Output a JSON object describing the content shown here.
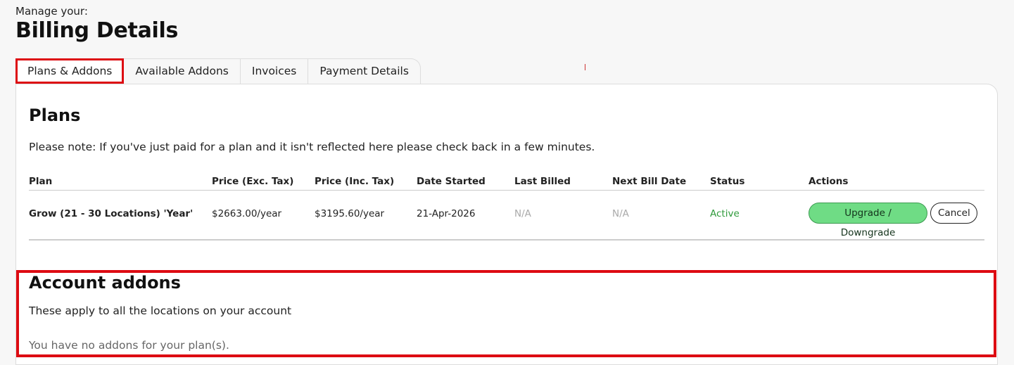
{
  "header": {
    "subtitle": "Manage your:",
    "title": "Billing Details"
  },
  "tabs": [
    {
      "label": "Plans & Addons",
      "active": true
    },
    {
      "label": "Available Addons",
      "active": false
    },
    {
      "label": "Invoices",
      "active": false
    },
    {
      "label": "Payment Details",
      "active": false
    }
  ],
  "plans": {
    "heading": "Plans",
    "note": "Please note: If you've just paid for a plan and it isn't reflected here please check back in a few minutes.",
    "columns": [
      "Plan",
      "Price (Exc. Tax)",
      "Price (Inc. Tax)",
      "Date Started",
      "Last Billed",
      "Next Bill Date",
      "Status",
      "Actions"
    ],
    "rows": [
      {
        "plan": "Grow (21 - 30 Locations) 'Year'",
        "price_exc": "$2663.00/year",
        "price_inc": "$3195.60/year",
        "date_started": "21-Apr-2026",
        "last_billed": "N/A",
        "next_bill": "N/A",
        "status": "Active",
        "actions": {
          "upgrade": "Upgrade / Downgrade",
          "cancel": "Cancel"
        }
      }
    ]
  },
  "addons": {
    "heading": "Account addons",
    "subtitle": "These apply to all the locations on your account",
    "empty": "You have no addons for your plan(s)."
  },
  "colors": {
    "highlight": "#dd0b12",
    "active_status": "#2e9a3a",
    "upgrade_button": "#6fdc85"
  }
}
